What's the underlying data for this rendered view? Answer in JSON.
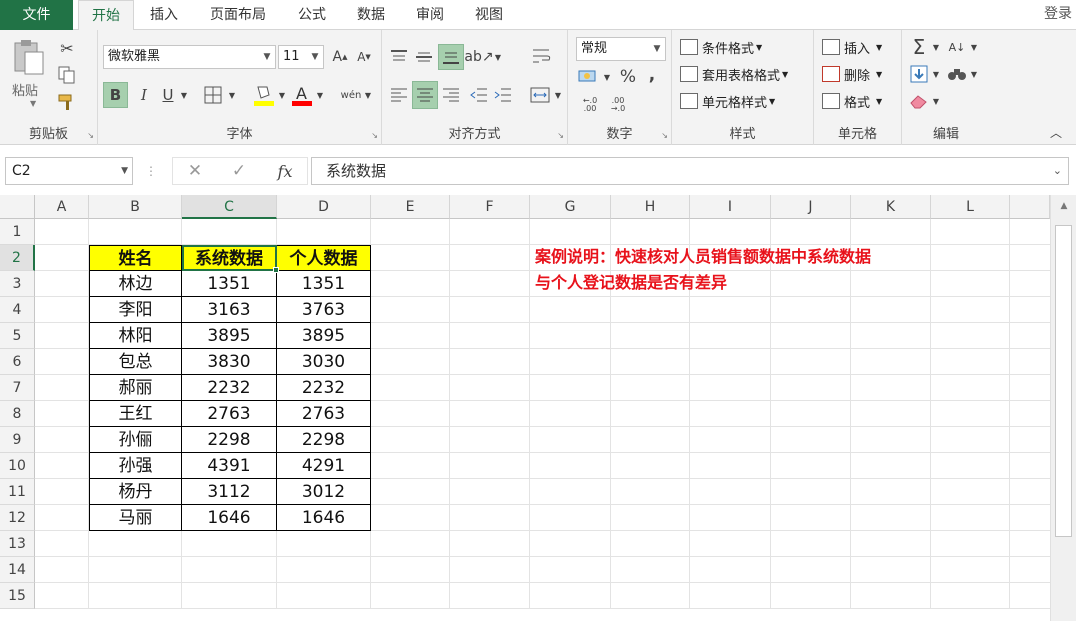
{
  "tabs": {
    "file": "文件",
    "items": [
      "开始",
      "插入",
      "页面布局",
      "公式",
      "数据",
      "审阅",
      "视图"
    ],
    "active": "开始",
    "login": "登录"
  },
  "ribbon": {
    "clipboard": {
      "paste_label": "粘贴",
      "group_label": "剪贴板"
    },
    "font": {
      "name": "微软雅黑",
      "size": "11",
      "group_label": "字体",
      "bold": "B",
      "italic": "I",
      "underline": "U",
      "fill_color": "#ffff00",
      "font_color": "#ff0000"
    },
    "alignment": {
      "group_label": "对齐方式"
    },
    "number": {
      "format": "常规",
      "percent": "%",
      "comma": ",",
      "group_label": "数字"
    },
    "styles": {
      "conditional": "条件格式",
      "table": "套用表格格式",
      "cell_styles": "单元格样式",
      "group_label": "样式"
    },
    "cells": {
      "insert": "插入",
      "delete": "删除",
      "format": "格式",
      "group_label": "单元格"
    },
    "editing": {
      "sum": "Σ",
      "group_label": "编辑"
    }
  },
  "formula_bar": {
    "name_box": "C2",
    "cancel": "✕",
    "enter": "✓",
    "fx": "fx",
    "content": "系统数据"
  },
  "columns": [
    "A",
    "B",
    "C",
    "D",
    "E",
    "F",
    "G",
    "H",
    "I",
    "J",
    "K",
    "L"
  ],
  "rows": [
    "1",
    "2",
    "3",
    "4",
    "5",
    "6",
    "7",
    "8",
    "9",
    "10",
    "11",
    "12",
    "13",
    "14",
    "15"
  ],
  "active_cell": "C2",
  "table": {
    "headers": [
      "姓名",
      "系统数据",
      "个人数据"
    ],
    "rows": [
      [
        "林边",
        "1351",
        "1351"
      ],
      [
        "李阳",
        "3163",
        "3763"
      ],
      [
        "林阳",
        "3895",
        "3895"
      ],
      [
        "包总",
        "3830",
        "3030"
      ],
      [
        "郝丽",
        "2232",
        "2232"
      ],
      [
        "王红",
        "2763",
        "2763"
      ],
      [
        "孙俪",
        "2298",
        "2298"
      ],
      [
        "孙强",
        "4391",
        "4291"
      ],
      [
        "杨丹",
        "3112",
        "3012"
      ],
      [
        "马丽",
        "1646",
        "1646"
      ]
    ],
    "header_color": "#ffff00"
  },
  "note": {
    "line1": "案例说明：快速核对人员销售额数据中系统数据",
    "line2": "与个人登记数据是否有差异",
    "color": "#e8121b"
  }
}
